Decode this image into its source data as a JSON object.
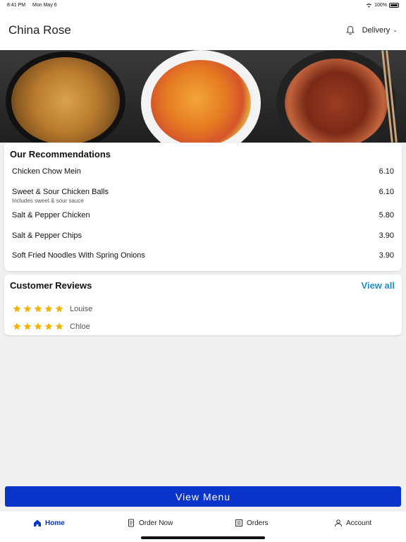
{
  "status_bar": {
    "time": "8:41 PM",
    "date": "Mon May 6",
    "battery": "100%"
  },
  "header": {
    "title": "China Rose",
    "mode": "Delivery"
  },
  "recommendations": {
    "title": "Our Recommendations",
    "items": [
      {
        "name": "Chicken Chow Mein",
        "price": "6.10",
        "note": ""
      },
      {
        "name": "Sweet & Sour Chicken Balls",
        "price": "6.10",
        "note": "Includes sweet & sour sauce"
      },
      {
        "name": "Salt & Pepper Chicken",
        "price": "5.80",
        "note": ""
      },
      {
        "name": "Salt & Pepper Chips",
        "price": "3.90",
        "note": ""
      },
      {
        "name": "Soft Fried Noodles With Spring Onions",
        "price": "3.90",
        "note": ""
      }
    ]
  },
  "reviews": {
    "title": "Customer Reviews",
    "view_all": "View all",
    "items": [
      {
        "name": "Louise",
        "rating": 5
      },
      {
        "name": "Chloe",
        "rating": 5
      }
    ]
  },
  "view_menu_label": "View Menu",
  "tabs": [
    {
      "label": "Home",
      "icon": "home-icon",
      "active": true
    },
    {
      "label": "Order Now",
      "icon": "order-icon",
      "active": false
    },
    {
      "label": "Orders",
      "icon": "receipt-icon",
      "active": false
    },
    {
      "label": "Account",
      "icon": "person-icon",
      "active": false
    }
  ],
  "colors": {
    "accent": "#0a33c9",
    "link": "#1f8fc9",
    "star": "#f5b301"
  }
}
